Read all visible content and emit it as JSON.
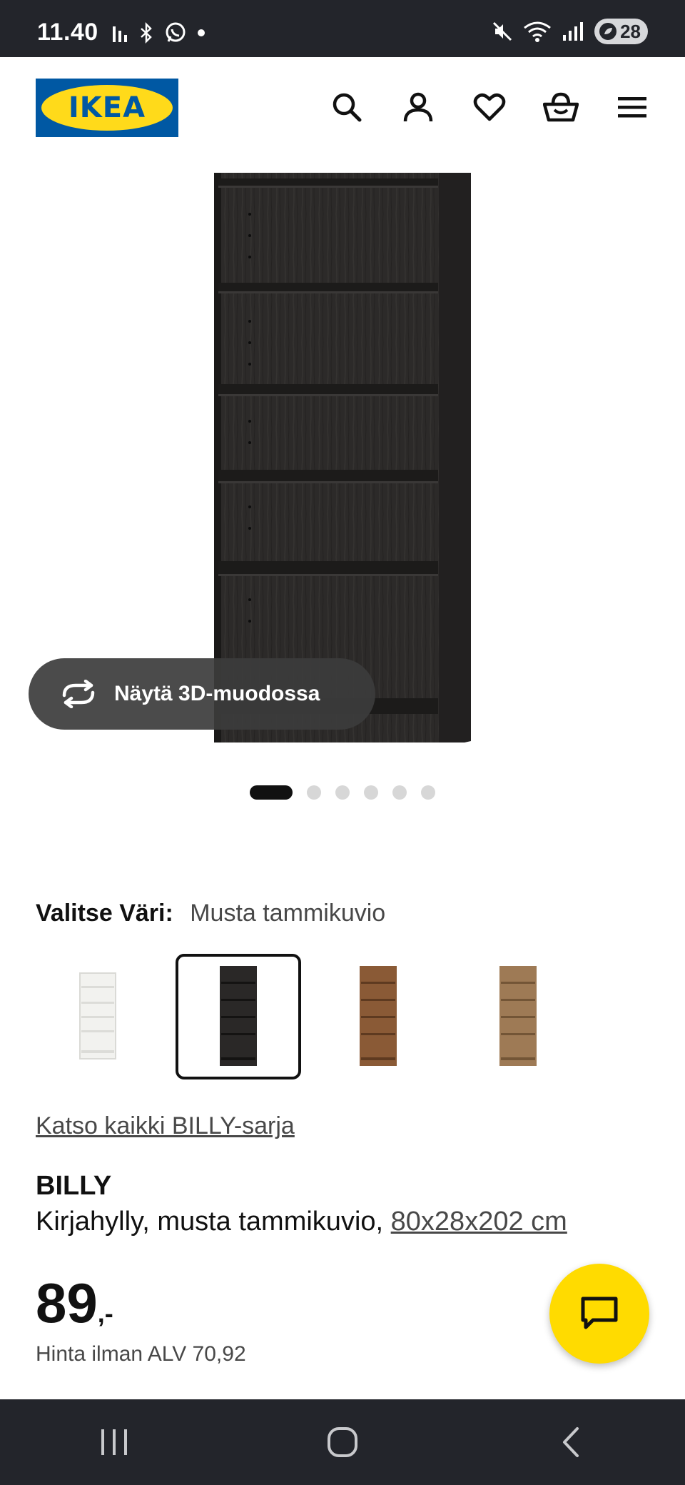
{
  "status_bar": {
    "time": "11.40",
    "battery": "28"
  },
  "header": {
    "logo_text": "IKEA",
    "icons": [
      "search-icon",
      "account-icon",
      "heart-icon",
      "basket-icon",
      "menu-icon"
    ]
  },
  "product_image": {
    "view_3d_label": "Näytä 3D-muodossa",
    "image_count": 6,
    "active_index": 0
  },
  "color_chooser": {
    "label": "Valitse Väri:",
    "selected": "Musta tammikuvio",
    "options": [
      {
        "color": "#f2f2ef",
        "shelf": "#e0e0dc"
      },
      {
        "color": "#2a2827",
        "shelf": "#1a1918"
      },
      {
        "color": "#8a5a36",
        "shelf": "#6e4426"
      },
      {
        "color": "#9e7a55",
        "shelf": "#84633f"
      }
    ],
    "selected_index": 1
  },
  "series_link": "Katso kaikki BILLY-sarja",
  "product": {
    "name": "BILLY",
    "description": "Kirjahylly, musta tammikuvio,",
    "dimensions": "80x28x202 cm",
    "price": "89",
    "price_suffix": ",-",
    "vat_text": "Hinta ilman ALV 70,92"
  },
  "colors": {
    "ikea_blue": "#0058a3",
    "ikea_yellow": "#ffda1a",
    "fab_yellow": "#ffdb00",
    "system_bar": "#23252b"
  }
}
